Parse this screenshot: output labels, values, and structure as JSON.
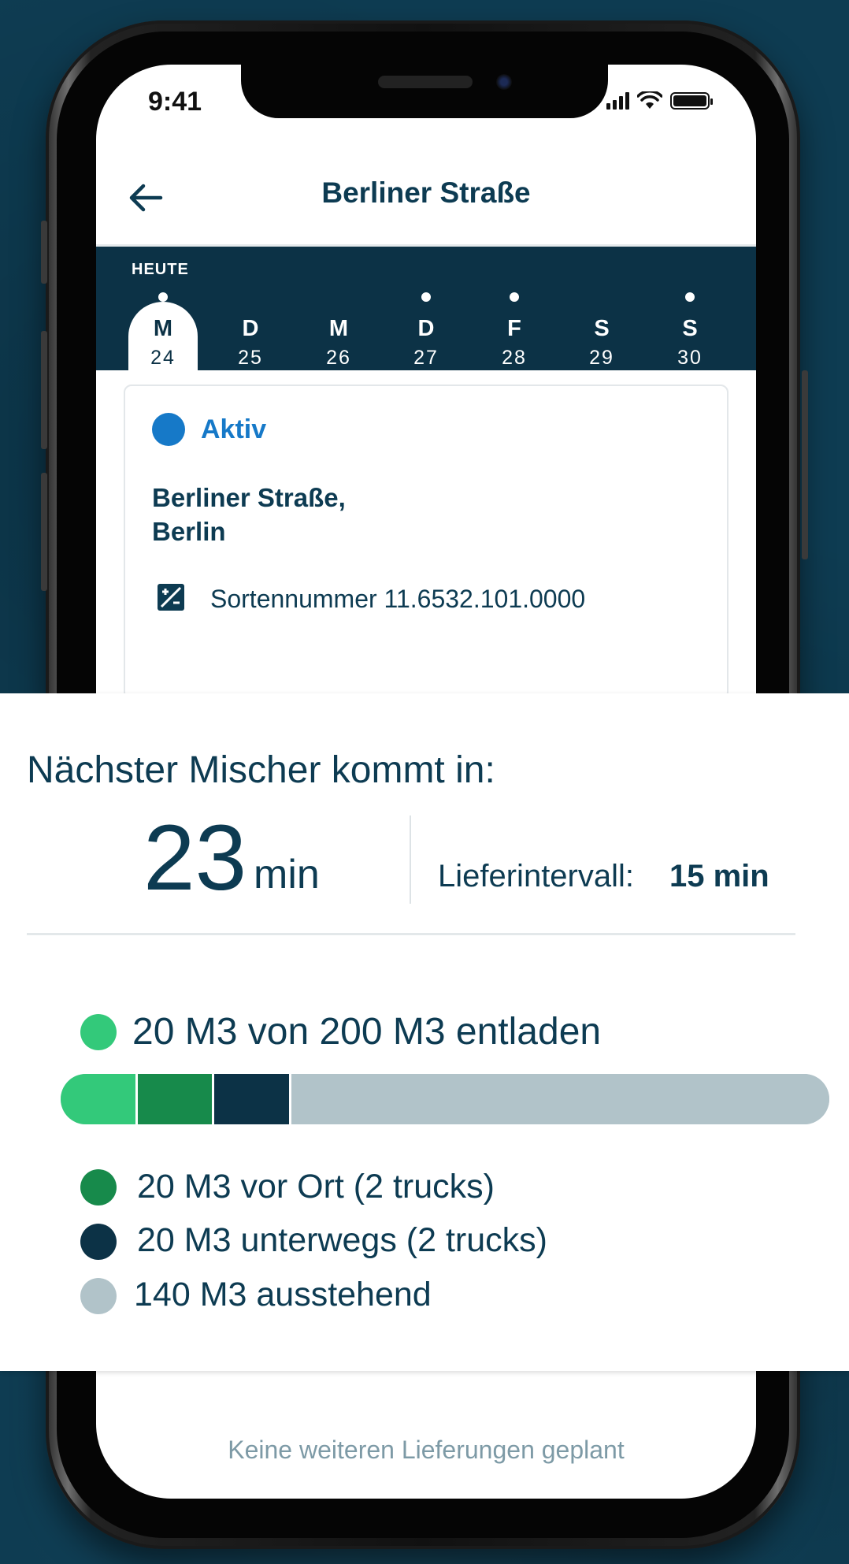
{
  "status_bar": {
    "time": "9:41"
  },
  "header": {
    "title": "Berliner Straße"
  },
  "day_strip": {
    "today_label": "HEUTE",
    "days": [
      {
        "letter": "M",
        "num": "24",
        "dot": true,
        "selected": true
      },
      {
        "letter": "D",
        "num": "25",
        "dot": false,
        "selected": false
      },
      {
        "letter": "M",
        "num": "26",
        "dot": false,
        "selected": false
      },
      {
        "letter": "D",
        "num": "27",
        "dot": true,
        "selected": false
      },
      {
        "letter": "F",
        "num": "28",
        "dot": true,
        "selected": false
      },
      {
        "letter": "S",
        "num": "29",
        "dot": false,
        "selected": false
      },
      {
        "letter": "S",
        "num": "30",
        "dot": true,
        "selected": false
      }
    ]
  },
  "card": {
    "status": "Aktiv",
    "address_line1": "Berliner Straße,",
    "address_line2": "Berlin",
    "sorte": "Sortennummer 11.6532.101.0000"
  },
  "footer": {
    "no_more": "Keine weiteren Lieferungen geplant"
  },
  "panel": {
    "next_label": "Nächster Mischer kommt in:",
    "next_value": "23",
    "next_unit": "min",
    "interval_label": "Lieferintervall:",
    "interval_value": "15 min",
    "unloaded": "20 M3 von 200 M3 entladen",
    "onsite": "20 M3 vor Ort (2 trucks)",
    "enroute": "20 M3 unterwegs (2 trucks)",
    "pending": "140 M3 ausstehend",
    "progress": {
      "total": 200,
      "segments": [
        {
          "name": "entladen",
          "value": 20,
          "color": "#33c97a"
        },
        {
          "name": "vor Ort",
          "value": 20,
          "color": "#178a4b"
        },
        {
          "name": "unterwegs",
          "value": 20,
          "color": "#0c3246"
        },
        {
          "name": "ausstehend",
          "value": 140,
          "color": "#b1c3c9"
        }
      ]
    }
  },
  "colors": {
    "accent": "#1679c8",
    "navy": "#0c3246",
    "text": "#0d3b52",
    "green_light": "#33c97a",
    "green_dark": "#178a4b",
    "grey": "#b1c3c9"
  }
}
